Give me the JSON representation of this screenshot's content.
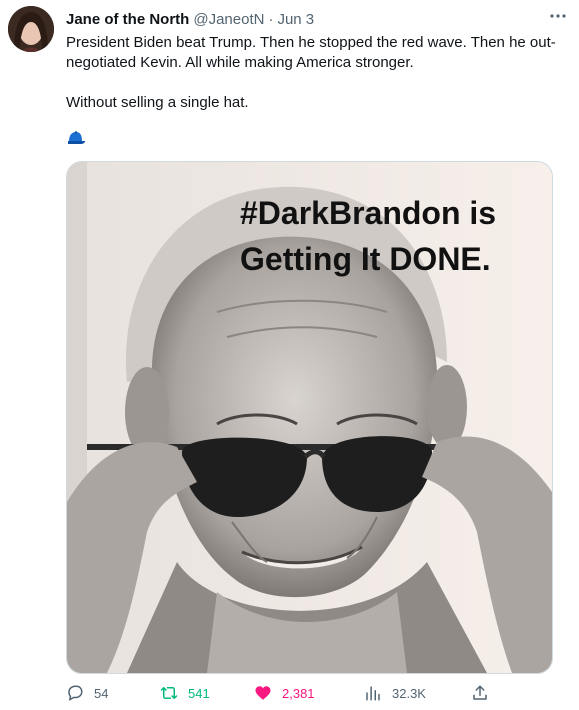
{
  "tweet": {
    "author_name": "Jane of the North",
    "handle": "@JaneotN",
    "separator": "·",
    "date": "Jun 3",
    "text_line1": "President Biden beat Trump. Then he stopped the red wave. Then he out-negotiated Kevin. All while making America stronger.",
    "text_line2": "Without selling a single hat.",
    "emoji": "blue-cap-icon"
  },
  "media": {
    "caption_line1": "#DarkBrandon is",
    "caption_line2": "Getting It DONE."
  },
  "actions": {
    "replies": "54",
    "retweets": "541",
    "likes": "2,381",
    "views": "32.3K"
  },
  "colors": {
    "retweet": "#00ba7c",
    "like": "#f91880",
    "muted": "#536471",
    "emoji_cap": "#1d6fd1"
  }
}
